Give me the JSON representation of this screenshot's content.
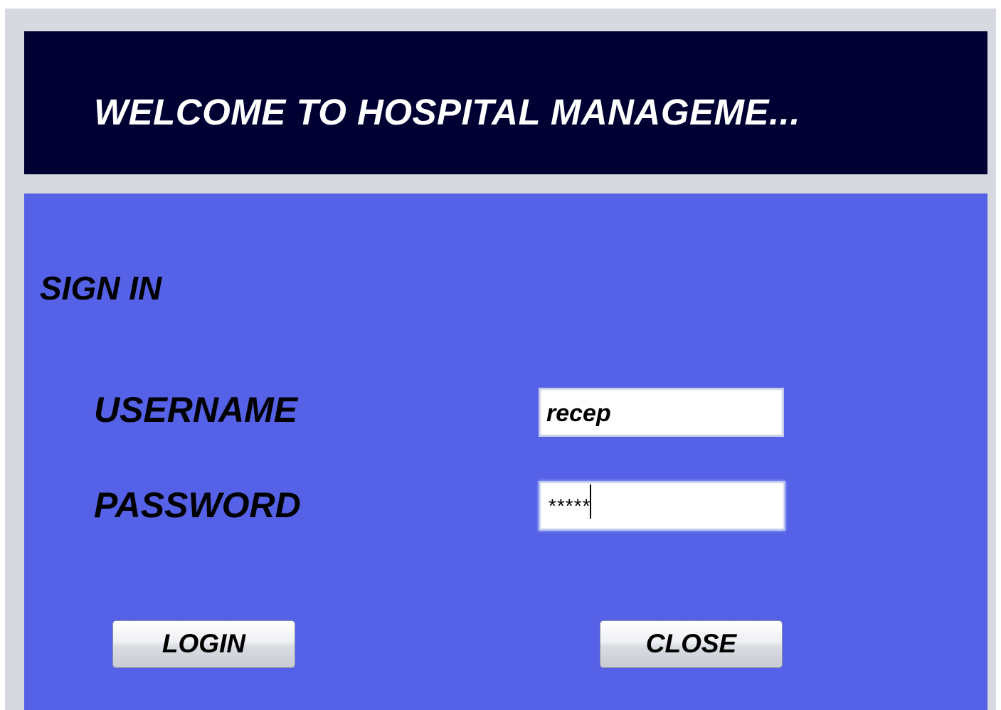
{
  "header": {
    "title": "WELCOME TO HOSPITAL MANAGEME..."
  },
  "form": {
    "heading": "SIGN IN",
    "username_label": "USERNAME",
    "username_value": "recep",
    "password_label": "PASSWORD",
    "password_value": "*****"
  },
  "buttons": {
    "login_label": "LOGIN",
    "close_label": "CLOSE"
  },
  "colors": {
    "header_bg": "#000033",
    "panel_bg": "#5562e8",
    "frame_bg": "#d7d9e0"
  }
}
